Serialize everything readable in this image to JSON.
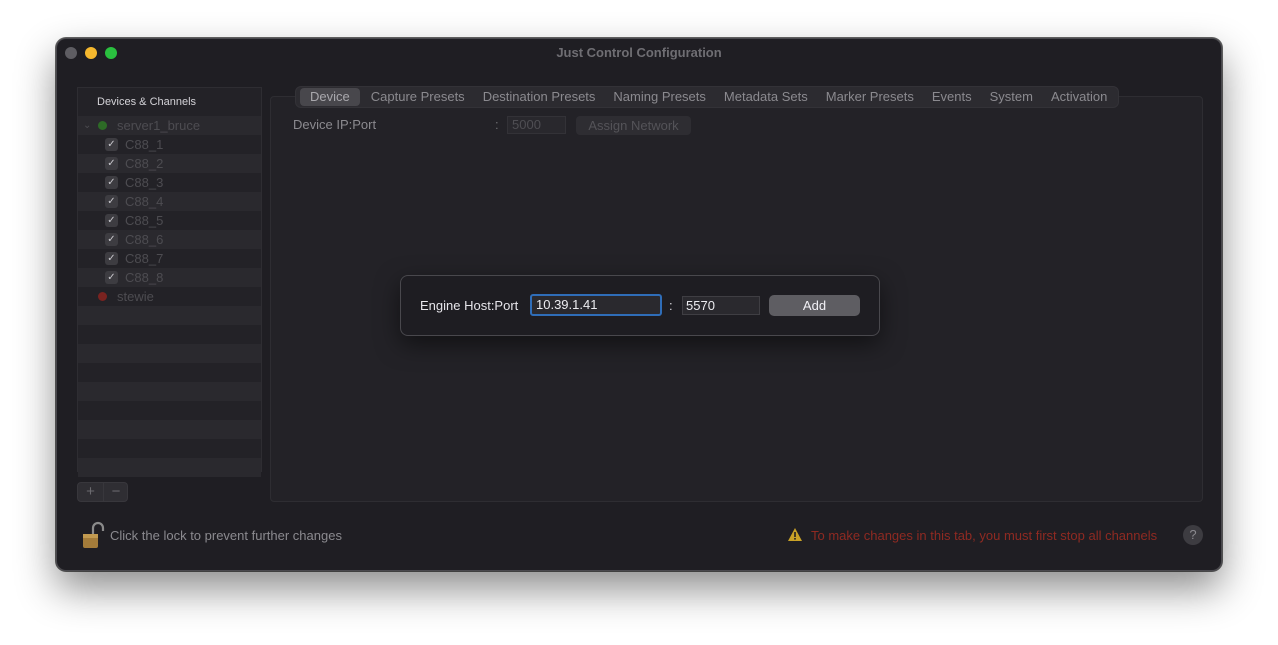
{
  "window": {
    "title": "Just Control Configuration"
  },
  "sidebar": {
    "header": "Devices & Channels",
    "servers": [
      {
        "name": "server1_bruce",
        "status_color": "#2d6a26",
        "expanded": true,
        "channels": [
          "C88_1",
          "C88_2",
          "C88_3",
          "C88_4",
          "C88_5",
          "C88_6",
          "C88_7",
          "C88_8"
        ]
      },
      {
        "name": "stewie",
        "status_color": "#7a2320",
        "expanded": false,
        "channels": []
      }
    ],
    "add_label": "+",
    "remove_label": "−"
  },
  "tabs": [
    "Device",
    "Capture Presets",
    "Destination Presets",
    "Naming Presets",
    "Metadata Sets",
    "Marker Presets",
    "Events",
    "System",
    "Activation"
  ],
  "active_tab": "Device",
  "device": {
    "label": "Device IP:Port",
    "colon": ":",
    "port_placeholder": "5000",
    "assign_label": "Assign Network"
  },
  "dialog": {
    "label": "Engine Host:Port",
    "host_value": "10.39.1.41",
    "colon": ":",
    "port_value": "5570",
    "add_label": "Add"
  },
  "footer": {
    "lock_text": "Click the lock to prevent further changes",
    "warning_text": "To make changes in this tab, you must first stop all channels",
    "help_label": "?"
  },
  "colors": {
    "accent": "#2f6db8",
    "warning": "#8f2a22"
  }
}
